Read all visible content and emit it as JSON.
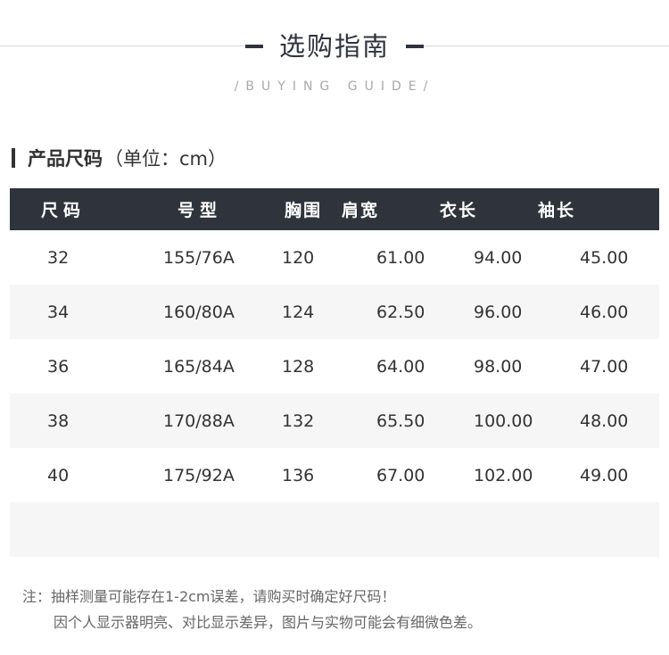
{
  "header": {
    "title": "选购指南",
    "subtitle": "/BUYING GUIDE/"
  },
  "section": {
    "title": "产品尺码",
    "unit": "（单位：cm）"
  },
  "table": {
    "headers": [
      "尺码",
      "号型",
      "胸围",
      "肩宽",
      "衣长",
      "袖长"
    ],
    "rows": [
      [
        "32",
        "155/76A",
        "120",
        "61.00",
        "94.00",
        "45.00"
      ],
      [
        "34",
        "160/80A",
        "124",
        "62.50",
        "96.00",
        "46.00"
      ],
      [
        "36",
        "165/84A",
        "128",
        "64.00",
        "98.00",
        "47.00"
      ],
      [
        "38",
        "170/88A",
        "132",
        "65.50",
        "100.00",
        "48.00"
      ],
      [
        "40",
        "175/92A",
        "136",
        "67.00",
        "102.00",
        "49.00"
      ]
    ]
  },
  "notes": {
    "line1": "注：抽样测量可能存在1-2cm误差，请购买时确定好尺码！",
    "line2": "因个人显示器明亮、对比显示差异，图片与实物可能会有细微色差。"
  },
  "colors": {
    "header_bg": "#2f333c",
    "stripe": "#f6f6f6"
  }
}
